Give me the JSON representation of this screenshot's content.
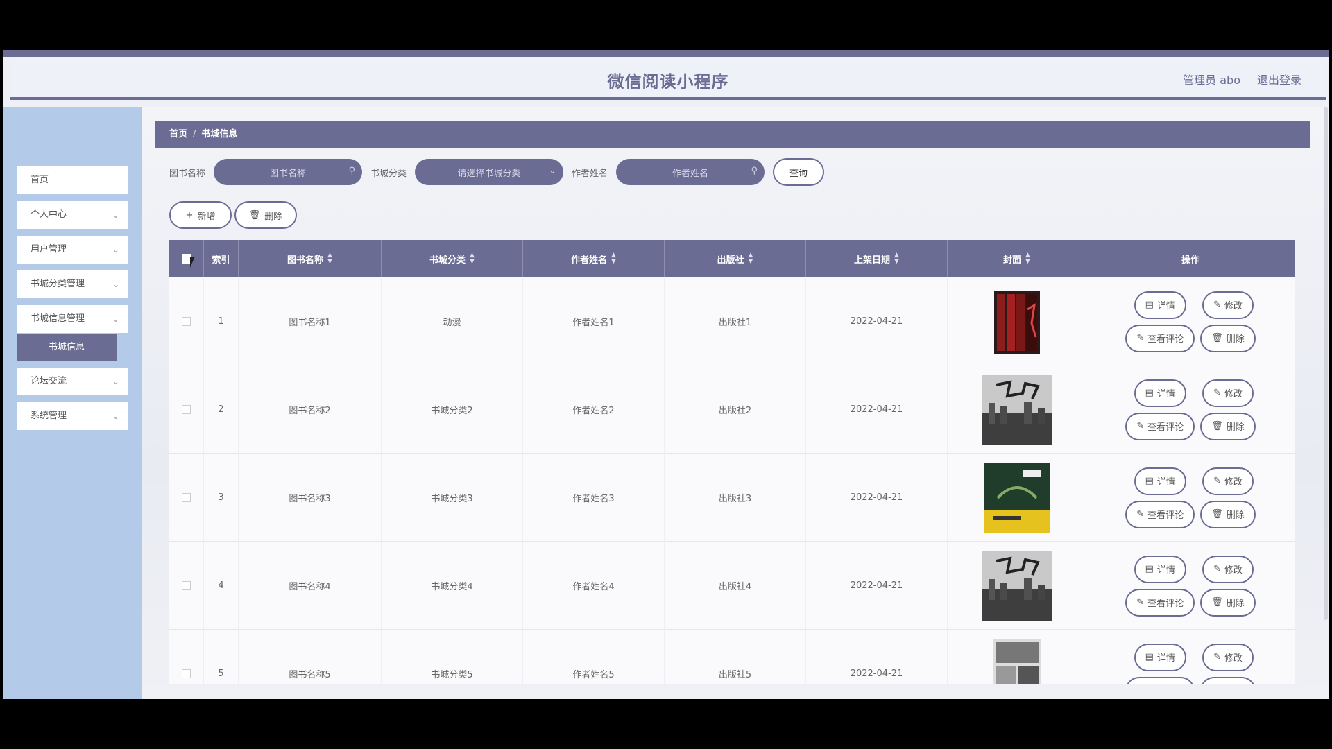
{
  "app": {
    "title": "微信阅读小程序",
    "admin_label": "管理员 abo",
    "logout_label": "退出登录"
  },
  "sidebar": {
    "items": [
      {
        "label": "首页",
        "has_chevron": false
      },
      {
        "label": "个人中心",
        "has_chevron": true
      },
      {
        "label": "用户管理",
        "has_chevron": true
      },
      {
        "label": "书城分类管理",
        "has_chevron": true
      },
      {
        "label": "书城信息管理",
        "has_chevron": true
      },
      {
        "label": "论坛交流",
        "has_chevron": true
      },
      {
        "label": "系统管理",
        "has_chevron": true
      }
    ],
    "active_subitem": "书城信息"
  },
  "breadcrumb": {
    "home": "首页",
    "separator": "/",
    "current": "书城信息"
  },
  "search": {
    "book_name_label": "图书名称",
    "book_name_placeholder": "图书名称",
    "category_label": "书城分类",
    "category_placeholder": "请选择书城分类",
    "author_label": "作者姓名",
    "author_placeholder": "作者姓名",
    "query_button": "查询"
  },
  "actions": {
    "add_label": "新增",
    "delete_label": "删除"
  },
  "table": {
    "headers": {
      "index": "索引",
      "book_name": "图书名称",
      "category": "书城分类",
      "author": "作者姓名",
      "publisher": "出版社",
      "date": "上架日期",
      "cover": "封面",
      "operations": "操作"
    },
    "op_labels": {
      "detail": "详情",
      "edit": "修改",
      "comments": "查看评论",
      "delete": "删除"
    },
    "rows": [
      {
        "index": "1",
        "book_name": "图书名称1",
        "category": "动漫",
        "author": "作者姓名1",
        "publisher": "出版社1",
        "date": "2022-04-21",
        "cover": "red-box-set"
      },
      {
        "index": "2",
        "book_name": "图书名称2",
        "category": "书城分类2",
        "author": "作者姓名2",
        "publisher": "出版社2",
        "date": "2022-04-21",
        "cover": "grey-city"
      },
      {
        "index": "3",
        "book_name": "图书名称3",
        "category": "书城分类3",
        "author": "作者姓名3",
        "publisher": "出版社3",
        "date": "2022-04-21",
        "cover": "green-yellow"
      },
      {
        "index": "4",
        "book_name": "图书名称4",
        "category": "书城分类4",
        "author": "作者姓名4",
        "publisher": "出版社4",
        "date": "2022-04-21",
        "cover": "grey-city"
      },
      {
        "index": "5",
        "book_name": "图书名称5",
        "category": "书城分类5",
        "author": "作者姓名5",
        "publisher": "出版社5",
        "date": "2022-04-21",
        "cover": "comic"
      }
    ]
  },
  "colors": {
    "primary": "#6b6c93",
    "sidebar_bg": "#b3cbe8",
    "header_bg": "#eef1f8"
  }
}
